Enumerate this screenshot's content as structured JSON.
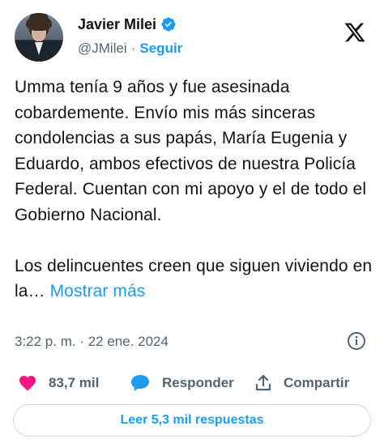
{
  "author": {
    "display_name": "Javier Milei",
    "handle": "@JMilei",
    "separator": "·",
    "follow_label": "Seguir"
  },
  "tweet": {
    "paragraph1": "Umma tenía 9 años y fue asesinada cobardemente. Envío mis más sinceras condolencias a sus papás, María Eugenia y Eduardo, ambos efectivos de nuestra Policía Federal. Cuentan con mi apoyo y el de todo el Gobierno Nacional.",
    "paragraph2": "Los delincuentes creen que siguen viviendo en la…",
    "show_more_label": "Mostrar más",
    "timestamp": "3:22 p. m. · 22 ene. 2024"
  },
  "actions": {
    "like_count": "83,7 mil",
    "reply_label": "Responder",
    "share_label": "Compartir",
    "read_replies_label": "Leer 5,3 mil respuestas"
  },
  "colors": {
    "accent": "#1d9bf0",
    "like": "#f91880",
    "text": "#0f1419",
    "secondary": "#536471"
  },
  "icons": {
    "verified": "verified-badge-icon",
    "platform": "x-logo-icon",
    "info": "info-icon",
    "like": "heart-icon",
    "reply": "comment-bubble-icon",
    "share": "share-icon"
  }
}
